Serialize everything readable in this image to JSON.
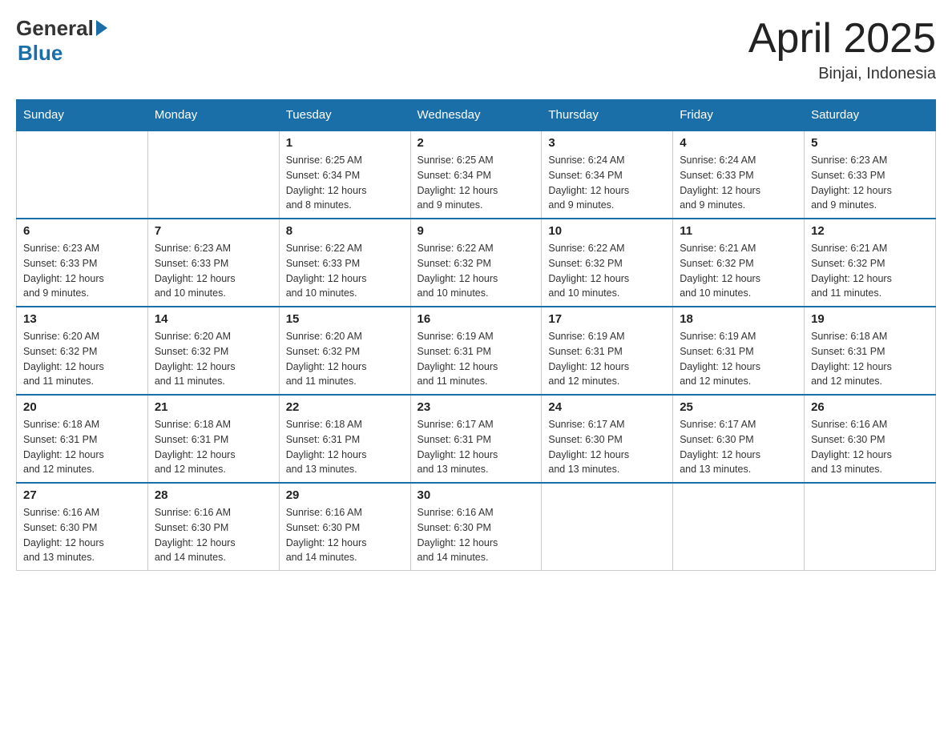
{
  "header": {
    "logo_general": "General",
    "logo_blue": "Blue",
    "month": "April 2025",
    "location": "Binjai, Indonesia"
  },
  "days_of_week": [
    "Sunday",
    "Monday",
    "Tuesday",
    "Wednesday",
    "Thursday",
    "Friday",
    "Saturday"
  ],
  "weeks": [
    [
      {
        "day": "",
        "info": ""
      },
      {
        "day": "",
        "info": ""
      },
      {
        "day": "1",
        "info": "Sunrise: 6:25 AM\nSunset: 6:34 PM\nDaylight: 12 hours\nand 8 minutes."
      },
      {
        "day": "2",
        "info": "Sunrise: 6:25 AM\nSunset: 6:34 PM\nDaylight: 12 hours\nand 9 minutes."
      },
      {
        "day": "3",
        "info": "Sunrise: 6:24 AM\nSunset: 6:34 PM\nDaylight: 12 hours\nand 9 minutes."
      },
      {
        "day": "4",
        "info": "Sunrise: 6:24 AM\nSunset: 6:33 PM\nDaylight: 12 hours\nand 9 minutes."
      },
      {
        "day": "5",
        "info": "Sunrise: 6:23 AM\nSunset: 6:33 PM\nDaylight: 12 hours\nand 9 minutes."
      }
    ],
    [
      {
        "day": "6",
        "info": "Sunrise: 6:23 AM\nSunset: 6:33 PM\nDaylight: 12 hours\nand 9 minutes."
      },
      {
        "day": "7",
        "info": "Sunrise: 6:23 AM\nSunset: 6:33 PM\nDaylight: 12 hours\nand 10 minutes."
      },
      {
        "day": "8",
        "info": "Sunrise: 6:22 AM\nSunset: 6:33 PM\nDaylight: 12 hours\nand 10 minutes."
      },
      {
        "day": "9",
        "info": "Sunrise: 6:22 AM\nSunset: 6:32 PM\nDaylight: 12 hours\nand 10 minutes."
      },
      {
        "day": "10",
        "info": "Sunrise: 6:22 AM\nSunset: 6:32 PM\nDaylight: 12 hours\nand 10 minutes."
      },
      {
        "day": "11",
        "info": "Sunrise: 6:21 AM\nSunset: 6:32 PM\nDaylight: 12 hours\nand 10 minutes."
      },
      {
        "day": "12",
        "info": "Sunrise: 6:21 AM\nSunset: 6:32 PM\nDaylight: 12 hours\nand 11 minutes."
      }
    ],
    [
      {
        "day": "13",
        "info": "Sunrise: 6:20 AM\nSunset: 6:32 PM\nDaylight: 12 hours\nand 11 minutes."
      },
      {
        "day": "14",
        "info": "Sunrise: 6:20 AM\nSunset: 6:32 PM\nDaylight: 12 hours\nand 11 minutes."
      },
      {
        "day": "15",
        "info": "Sunrise: 6:20 AM\nSunset: 6:32 PM\nDaylight: 12 hours\nand 11 minutes."
      },
      {
        "day": "16",
        "info": "Sunrise: 6:19 AM\nSunset: 6:31 PM\nDaylight: 12 hours\nand 11 minutes."
      },
      {
        "day": "17",
        "info": "Sunrise: 6:19 AM\nSunset: 6:31 PM\nDaylight: 12 hours\nand 12 minutes."
      },
      {
        "day": "18",
        "info": "Sunrise: 6:19 AM\nSunset: 6:31 PM\nDaylight: 12 hours\nand 12 minutes."
      },
      {
        "day": "19",
        "info": "Sunrise: 6:18 AM\nSunset: 6:31 PM\nDaylight: 12 hours\nand 12 minutes."
      }
    ],
    [
      {
        "day": "20",
        "info": "Sunrise: 6:18 AM\nSunset: 6:31 PM\nDaylight: 12 hours\nand 12 minutes."
      },
      {
        "day": "21",
        "info": "Sunrise: 6:18 AM\nSunset: 6:31 PM\nDaylight: 12 hours\nand 12 minutes."
      },
      {
        "day": "22",
        "info": "Sunrise: 6:18 AM\nSunset: 6:31 PM\nDaylight: 12 hours\nand 13 minutes."
      },
      {
        "day": "23",
        "info": "Sunrise: 6:17 AM\nSunset: 6:31 PM\nDaylight: 12 hours\nand 13 minutes."
      },
      {
        "day": "24",
        "info": "Sunrise: 6:17 AM\nSunset: 6:30 PM\nDaylight: 12 hours\nand 13 minutes."
      },
      {
        "day": "25",
        "info": "Sunrise: 6:17 AM\nSunset: 6:30 PM\nDaylight: 12 hours\nand 13 minutes."
      },
      {
        "day": "26",
        "info": "Sunrise: 6:16 AM\nSunset: 6:30 PM\nDaylight: 12 hours\nand 13 minutes."
      }
    ],
    [
      {
        "day": "27",
        "info": "Sunrise: 6:16 AM\nSunset: 6:30 PM\nDaylight: 12 hours\nand 13 minutes."
      },
      {
        "day": "28",
        "info": "Sunrise: 6:16 AM\nSunset: 6:30 PM\nDaylight: 12 hours\nand 14 minutes."
      },
      {
        "day": "29",
        "info": "Sunrise: 6:16 AM\nSunset: 6:30 PM\nDaylight: 12 hours\nand 14 minutes."
      },
      {
        "day": "30",
        "info": "Sunrise: 6:16 AM\nSunset: 6:30 PM\nDaylight: 12 hours\nand 14 minutes."
      },
      {
        "day": "",
        "info": ""
      },
      {
        "day": "",
        "info": ""
      },
      {
        "day": "",
        "info": ""
      }
    ]
  ]
}
